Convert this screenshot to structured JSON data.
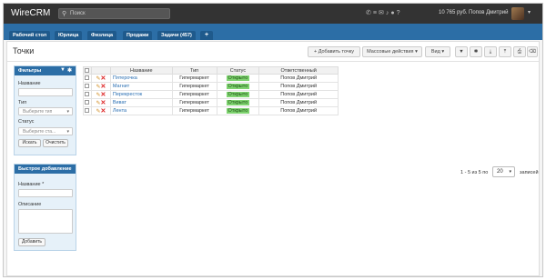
{
  "topbar": {
    "logo": "WireCRM",
    "search_placeholder": "Поиск",
    "balance": "10 765 руб.",
    "user": "Попов Дмитрий",
    "icons": [
      "phone-icon",
      "list-icon",
      "mail-icon",
      "bell-icon",
      "chat-icon",
      "help-icon"
    ]
  },
  "tabs": [
    {
      "label": "Рабочий стол"
    },
    {
      "label": "Юрлица"
    },
    {
      "label": "Физлица"
    },
    {
      "label": "Продажи"
    },
    {
      "label": "Задачи (457)"
    },
    {
      "label": "+"
    }
  ],
  "page": {
    "title": "Точки",
    "add_button": "Добавить точку",
    "mass_actions": "Массовые действия",
    "view": "Вид"
  },
  "filters": {
    "title": "Фильтры",
    "name_label": "Название",
    "type_label": "Тип",
    "type_placeholder": "Выберите тип",
    "status_label": "Статус",
    "status_placeholder": "Выберите ста...",
    "search_button": "Искать",
    "clear_button": "Очистить"
  },
  "quick_add": {
    "title": "Быстрое добавление",
    "name_label": "Название *",
    "desc_label": "Описание",
    "add_button": "Добавить"
  },
  "table": {
    "headers": [
      "Название",
      "Тип",
      "Статус",
      "Ответственный"
    ],
    "rows": [
      {
        "name": "Пятерочка",
        "type": "Гипермаркет",
        "status": "Открыто",
        "owner": "Попов Дмитрий"
      },
      {
        "name": "Магнит",
        "type": "Гипермаркет",
        "status": "Открыто",
        "owner": "Попов Дмитрий"
      },
      {
        "name": "Перекресток",
        "type": "Гипермаркет",
        "status": "Открыто",
        "owner": "Попов Дмитрий"
      },
      {
        "name": "Виват",
        "type": "Гипермаркет",
        "status": "Открыто",
        "owner": "Попов Дмитрий"
      },
      {
        "name": "Лента",
        "type": "Гипермаркет",
        "status": "Открыто",
        "owner": "Попов Дмитрий"
      }
    ]
  },
  "pagination": {
    "range": "1 - 5 из 5 по",
    "per_page": "20",
    "suffix": "записей"
  },
  "colors": {
    "topbar": "#333333",
    "tabbar": "#2c6ea6",
    "status_open": "#7ed36f",
    "link": "#2a6fb3"
  }
}
